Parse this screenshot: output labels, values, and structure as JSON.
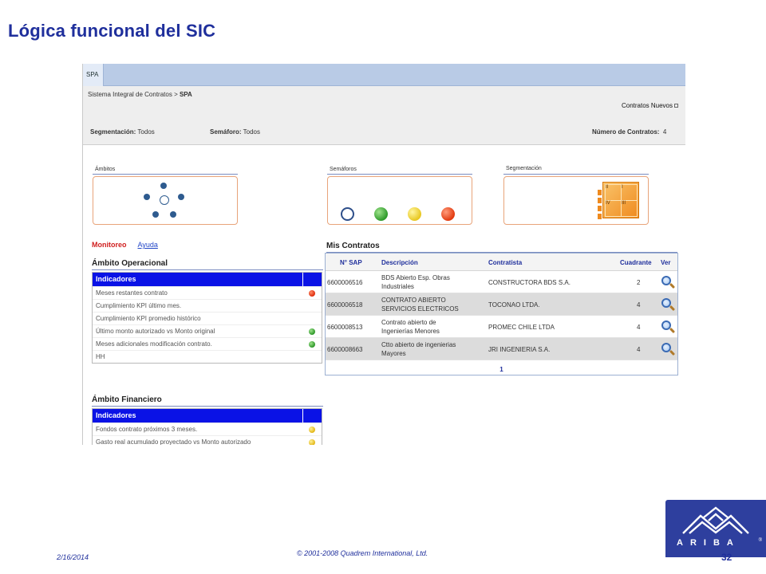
{
  "slide": {
    "title": "Lógica funcional del SIC",
    "date": "2/16/2014",
    "copyright": "© 2001-2008 Quadrem International, Ltd.",
    "page_number": "32",
    "logo_text": "ARIBA",
    "logo_reg": "®",
    "brand_color": "#2e3f9e"
  },
  "app": {
    "tab": "SPA",
    "breadcrumb_root": "Sistema Integral de Contratos",
    "breadcrumb_sep": " > ",
    "breadcrumb_current": "SPA",
    "new_contracts_link": "Contratos Nuevos",
    "filters": {
      "segmentacion_label": "Segmentación:",
      "segmentacion_value": "Todos",
      "semaforo_label": "Semáforo:",
      "semaforo_value": "Todos",
      "numero_label": "Número  de Contratos:",
      "numero_value": "4"
    },
    "panels": {
      "ambitos": "Ámbitos",
      "semaforos": "Semáforos",
      "segmentacion": "Segmentación",
      "seg_quadrants": [
        "II",
        "I",
        "IV",
        "III"
      ]
    },
    "monitor_tabs": {
      "active": "Monitoreo",
      "other": "Ayuda"
    },
    "operacional": {
      "title": "Ámbito Operacional",
      "header": "Indicadores",
      "rows": [
        {
          "label": "Meses restantes contrato",
          "status": "red"
        },
        {
          "label": "Cumplimiento KPI último mes.",
          "status": ""
        },
        {
          "label": "Cumplimiento KPI promedio histórico",
          "status": ""
        },
        {
          "label": "Último monto autorizado vs Monto original",
          "status": "green"
        },
        {
          "label": "Meses adicionales modificación contrato.",
          "status": "green"
        },
        {
          "label": "HH",
          "status": ""
        }
      ]
    },
    "financiero": {
      "title": "Ámbito Financiero",
      "header": "Indicadores",
      "rows": [
        {
          "label": "Fondos contrato próximos 3 meses.",
          "status": "yellow"
        },
        {
          "label": "Gasto real acumulado proyectado vs Monto autorizado",
          "status": "yellow"
        }
      ]
    },
    "mis_contratos": {
      "title": "Mis Contratos",
      "columns": {
        "sap": "N° SAP",
        "descripcion": "Descripción",
        "contratista": "Contratista",
        "cuadrante": "Cuadrante",
        "ver": "Ver"
      },
      "rows": [
        {
          "sap": "6600006516",
          "desc1": "BDS Abierto Esp. Obras",
          "desc2": "Industriales",
          "contratista": "CONSTRUCTORA BDS S.A.",
          "cuadrante": "2"
        },
        {
          "sap": "6600006518",
          "desc1": "CONTRATO ABIERTO",
          "desc2": "SERVICIOS ELECTRICOS",
          "contratista": "TOCONAO LTDA.",
          "cuadrante": "4"
        },
        {
          "sap": "6600008513",
          "desc1": "Contrato abierto de",
          "desc2": "Ingenierías Menores",
          "contratista": "PROMEC CHILE LTDA",
          "cuadrante": "4"
        },
        {
          "sap": "6600008663",
          "desc1": "Ctto abierto de ingenierias",
          "desc2": "Mayores",
          "contratista": "JRI INGENIERIA S.A.",
          "cuadrante": "4"
        }
      ],
      "pager": "1"
    }
  }
}
